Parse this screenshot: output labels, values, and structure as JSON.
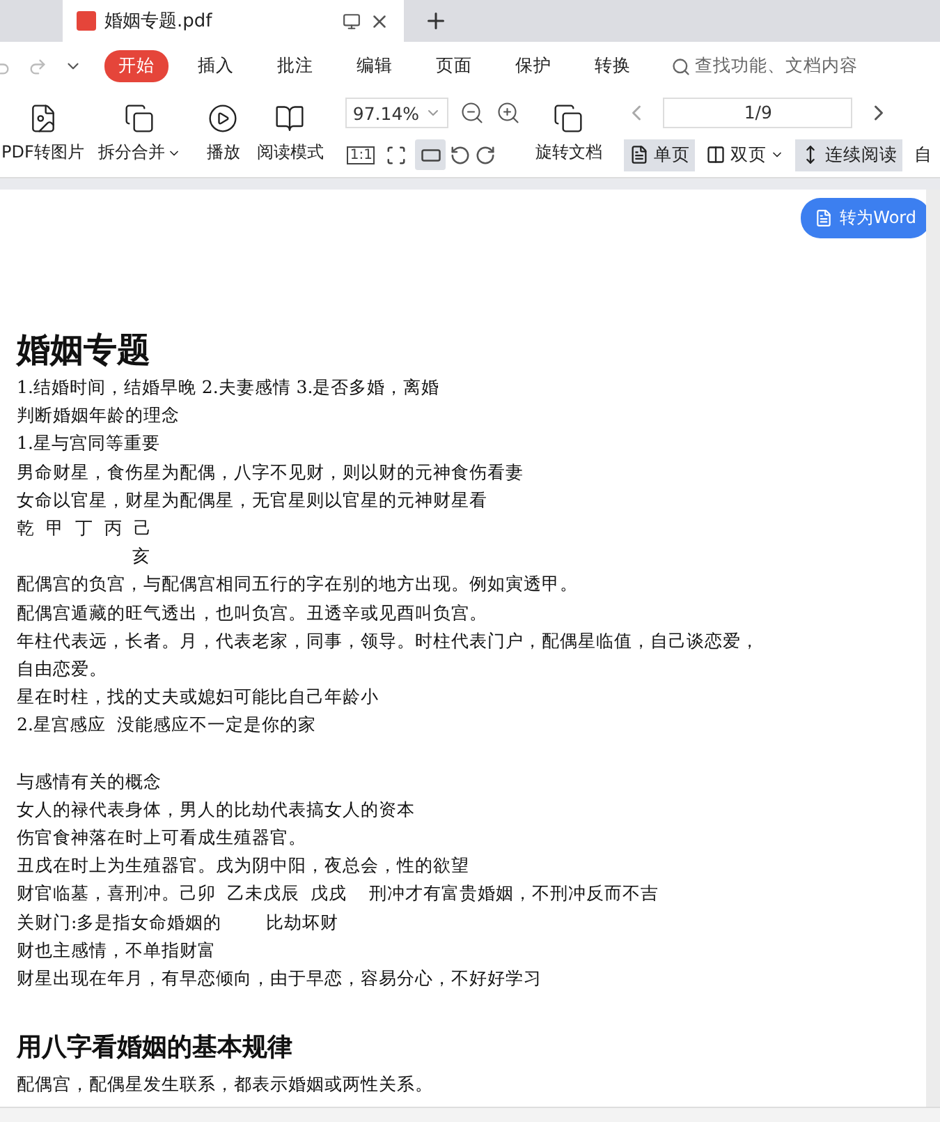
{
  "tabs": [
    {
      "label": "婚姻专题.pdf",
      "selected": true
    }
  ],
  "menu": [
    {
      "label": "开始",
      "selected": true
    },
    {
      "label": "插入",
      "selected": false
    },
    {
      "label": "批注",
      "selected": false
    },
    {
      "label": "编辑",
      "selected": false
    },
    {
      "label": "页面",
      "selected": false
    },
    {
      "label": "保护",
      "selected": false
    },
    {
      "label": "转换",
      "selected": false
    }
  ],
  "search": {
    "placeholder": "查找功能、文档内容"
  },
  "toolbar": {
    "pdf_to_image": "PDF转图片",
    "split_merge": "拆分合并",
    "play": "播放",
    "read_mode": "阅读模式",
    "zoom": "97.14%",
    "actual_size": "1:1",
    "rotate_doc": "旋转文档",
    "page": "1/9",
    "fit_modes": [
      {
        "kind": "fit-width",
        "selected": false
      },
      {
        "kind": "fit-page",
        "selected": true
      }
    ],
    "views": [
      {
        "label": "单页",
        "kind": "single",
        "selected": true,
        "dropdown": false
      },
      {
        "label": "双页",
        "kind": "double",
        "selected": false,
        "dropdown": true
      },
      {
        "label": "连续阅读",
        "kind": "continuous",
        "selected": true,
        "dropdown": false
      },
      {
        "label": "自",
        "kind": "plain",
        "selected": false,
        "dropdown": false
      }
    ]
  },
  "convert_button": "转为Word",
  "document": [
    {
      "kind": "title",
      "text": "婚姻专题"
    },
    {
      "kind": "line",
      "text": "1.结婚时间，结婚早晚 2.夫妻感情 3.是否多婚，离婚"
    },
    {
      "kind": "line",
      "text": "判断婚姻年龄的理念"
    },
    {
      "kind": "line",
      "text": "1.星与宫同等重要"
    },
    {
      "kind": "line",
      "text": "男命财星，食伤星为配偶，八字不见财，则以财的元神食伤看妻"
    },
    {
      "kind": "line",
      "text": "女命以官星，财星为配偶星，无官星则以官星的元神财星看"
    },
    {
      "kind": "line",
      "text": "乾  甲  丁  丙  己"
    },
    {
      "kind": "partial",
      "text": "亥"
    },
    {
      "kind": "line",
      "text": "配偶宫的负宫，与配偶宫相同五行的字在别的地方出现。例如寅透甲。"
    },
    {
      "kind": "line",
      "text": "配偶宫遁藏的旺气透出，也叫负宫。丑透辛或见酉叫负宫。"
    },
    {
      "kind": "line",
      "text": "年柱代表远，长者。月，代表老家，同事，领导。时柱代表门户，配偶星临值，自己谈恋爱，"
    },
    {
      "kind": "line",
      "text": "自由恋爱。"
    },
    {
      "kind": "line",
      "text": "星在时柱，找的丈夫或媳妇可能比自己年龄小"
    },
    {
      "kind": "line",
      "text": "2.星宫感应  没能感应不一定是你的家"
    },
    {
      "kind": "spaced",
      "text": "与感情有关的概念"
    },
    {
      "kind": "line",
      "text": "女人的禄代表身体，男人的比劫代表搞女人的资本"
    },
    {
      "kind": "line",
      "text": "伤官食神落在时上可看成生殖器官。"
    },
    {
      "kind": "line",
      "text": "丑戌在时上为生殖器官。戌为阴中阳，夜总会，性的欲望"
    },
    {
      "kind": "line",
      "text": "财官临墓，喜刑冲。己卯  乙未戊辰  戊戌    刑冲才有富贵婚姻，不刑冲反而不吉"
    },
    {
      "kind": "line",
      "text": "关财门:多是指女命婚姻的        比劫坏财"
    },
    {
      "kind": "line",
      "text": "财也主感情，不单指财富"
    },
    {
      "kind": "line",
      "text": "财星出现在年月，有早恋倾向，由于早恋，容易分心，不好好学习"
    },
    {
      "kind": "heading",
      "text": "用八字看婚姻的基本规律"
    },
    {
      "kind": "line",
      "text": "配偶宫，配偶星发生联系，都表示婚姻或两性关系。"
    }
  ]
}
